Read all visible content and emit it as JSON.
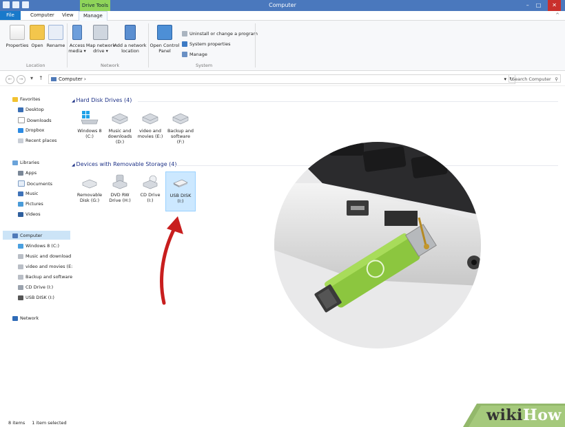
{
  "window": {
    "title": "Computer",
    "context_tab": "Drive Tools",
    "minimize": "–",
    "maximize": "□",
    "close": "✕",
    "collapse_ribbon": "^"
  },
  "tabs": {
    "file": "File",
    "computer": "Computer",
    "view": "View",
    "manage": "Manage"
  },
  "ribbon": {
    "location": {
      "label": "Location",
      "properties": "Properties",
      "open": "Open",
      "rename": "Rename"
    },
    "network": {
      "label": "Network",
      "access_media": "Access\nmedia ▾",
      "map_network_drive": "Map network\ndrive ▾",
      "add_network_location": "Add a network\nlocation"
    },
    "system": {
      "label": "System",
      "open_control_panel": "Open Control\nPanel",
      "uninstall": "Uninstall or change a program",
      "system_properties": "System properties",
      "manage": "Manage"
    }
  },
  "address": {
    "back": "←",
    "forward": "→",
    "up": "↑",
    "path": "Computer ›",
    "refresh": "↻",
    "dropdown": "▾",
    "search_placeholder": "Search Computer",
    "search_icon": "⚲"
  },
  "nav": {
    "favorites": {
      "label": "Favorites",
      "items": [
        "Desktop",
        "Downloads",
        "Dropbox",
        "Recent places"
      ]
    },
    "libraries": {
      "label": "Libraries",
      "items": [
        "Apps",
        "Documents",
        "Music",
        "Pictures",
        "Videos"
      ]
    },
    "computer": {
      "label": "Computer",
      "items": [
        "Windows 8 (C:)",
        "Music and download",
        "video and movies (E:",
        "Backup and software",
        "CD Drive (I:)",
        "USB DISK (I:)"
      ]
    },
    "network": {
      "label": "Network"
    }
  },
  "content": {
    "hard_disk_header": "Hard Disk Drives (4)",
    "removable_header": "Devices with Removable Storage (4)",
    "hard_disks": [
      {
        "line1": "Windows 8",
        "line2": "(C:)",
        "line3": ""
      },
      {
        "line1": "Music and",
        "line2": "downloads",
        "line3": "(D:)"
      },
      {
        "line1": "video and",
        "line2": "movies (E:)",
        "line3": ""
      },
      {
        "line1": "Backup and",
        "line2": "software",
        "line3": "(F:)"
      }
    ],
    "removable": [
      {
        "line1": "Removable",
        "line2": "Disk (G:)"
      },
      {
        "line1": "DVD RW",
        "line2": "Drive (H:)"
      },
      {
        "line1": "CD Drive",
        "line2": "(I:)"
      },
      {
        "line1": "USB DISK",
        "line2": "(I:)"
      }
    ]
  },
  "status": {
    "items": "8 items",
    "selected": "1 item selected"
  },
  "watermark": {
    "wiki": "wiki",
    "how": "How"
  },
  "icons": [
    "search-icon",
    "up-arrow-icon",
    "refresh-icon",
    "star-icon",
    "library-icon",
    "computer-icon",
    "network-icon",
    "hard-drive-icon",
    "usb-drive-icon",
    "dvd-drive-icon"
  ],
  "colors": {
    "titlebar": "#4a78bd",
    "context_tab": "#8fd45a",
    "file_tab": "#1979ca",
    "section_header": "#1e3287",
    "selection": "#cce8ff",
    "arrow": "#c81e1e",
    "usb_green": "#8cc63f"
  }
}
